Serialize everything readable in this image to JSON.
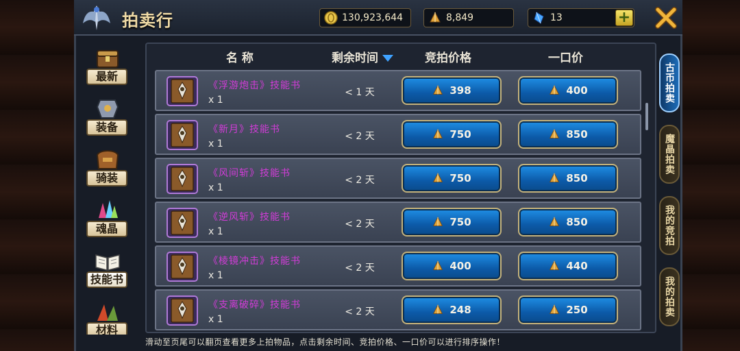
{
  "header": {
    "title": "拍卖行",
    "gold": "130,923,644",
    "crystal": "8,849",
    "diamond": "13"
  },
  "categories": [
    {
      "label": "最新",
      "icon": "treasure-chest-icon"
    },
    {
      "label": "装备",
      "icon": "armor-icon"
    },
    {
      "label": "骑装",
      "icon": "mount-gear-icon"
    },
    {
      "label": "魂晶",
      "icon": "soul-crystal-icon"
    },
    {
      "label": "技能书",
      "icon": "open-book-icon",
      "active": true
    },
    {
      "label": "材料",
      "icon": "materials-icon"
    }
  ],
  "columns": {
    "name": "名 称",
    "time": "剩余时间",
    "bid": "竞拍价格",
    "buyout": "一口价"
  },
  "items": [
    {
      "name": "《浮游炮击》技能书",
      "qty": "x 1",
      "time": "< 1 天",
      "bid": "398",
      "buyout": "400"
    },
    {
      "name": "《新月》技能书",
      "qty": "x 1",
      "time": "< 2 天",
      "bid": "750",
      "buyout": "850"
    },
    {
      "name": "《风间斩》技能书",
      "qty": "x 1",
      "time": "< 2 天",
      "bid": "750",
      "buyout": "850"
    },
    {
      "name": "《逆风斩》技能书",
      "qty": "x 1",
      "time": "< 2 天",
      "bid": "750",
      "buyout": "850"
    },
    {
      "name": "《棱镜冲击》技能书",
      "qty": "x 1",
      "time": "< 2 天",
      "bid": "400",
      "buyout": "440"
    },
    {
      "name": "《支离破碎》技能书",
      "qty": "x 1",
      "time": "< 2 天",
      "bid": "248",
      "buyout": "250"
    }
  ],
  "right_tabs": [
    {
      "label": "古币拍卖",
      "active": true
    },
    {
      "label": "魔晶拍卖"
    },
    {
      "label": "我的竞拍"
    },
    {
      "label": "我的拍卖"
    }
  ],
  "footer": "滑动至页尾可以翻页查看更多上拍物品，点击剩余时间、竞拍价格、一口价可以进行排序操作！",
  "colors": {
    "item_name": "#d23cd8",
    "price_button": "#1f8fe6",
    "sort_arrow": "#3fa2ff"
  }
}
